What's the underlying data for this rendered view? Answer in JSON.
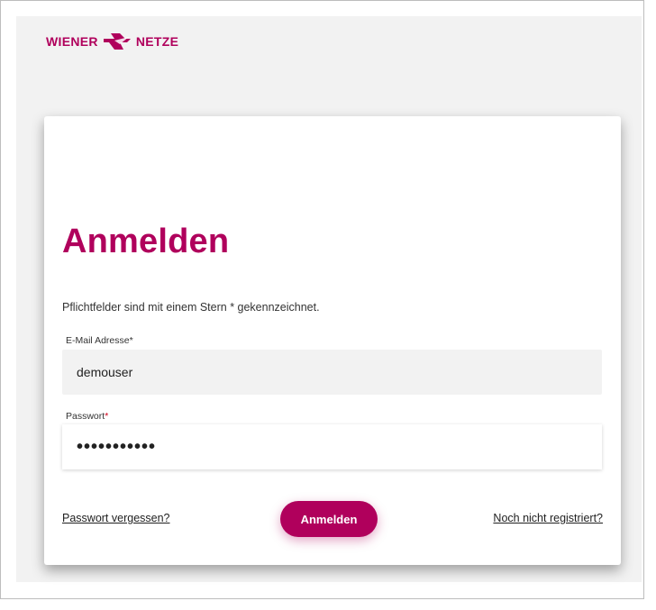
{
  "brand": {
    "name_left": "WIENER",
    "name_right": "NETZE",
    "logo_icon": "wiener-netze-logo-icon",
    "accent_color": "#b0005c"
  },
  "login": {
    "title": "Anmelden",
    "required_note": "Pflichtfelder sind mit einem Stern * gekennzeichnet.",
    "email_label": "E-Mail Adresse*",
    "email_value": "demouser",
    "password_label": "Passwort",
    "password_required_mark": "*",
    "password_value": "•••••••••••",
    "forgot_link": "Passwort vergessen?",
    "submit_label": "Anmelden",
    "register_link": "Noch nicht registriert?"
  }
}
